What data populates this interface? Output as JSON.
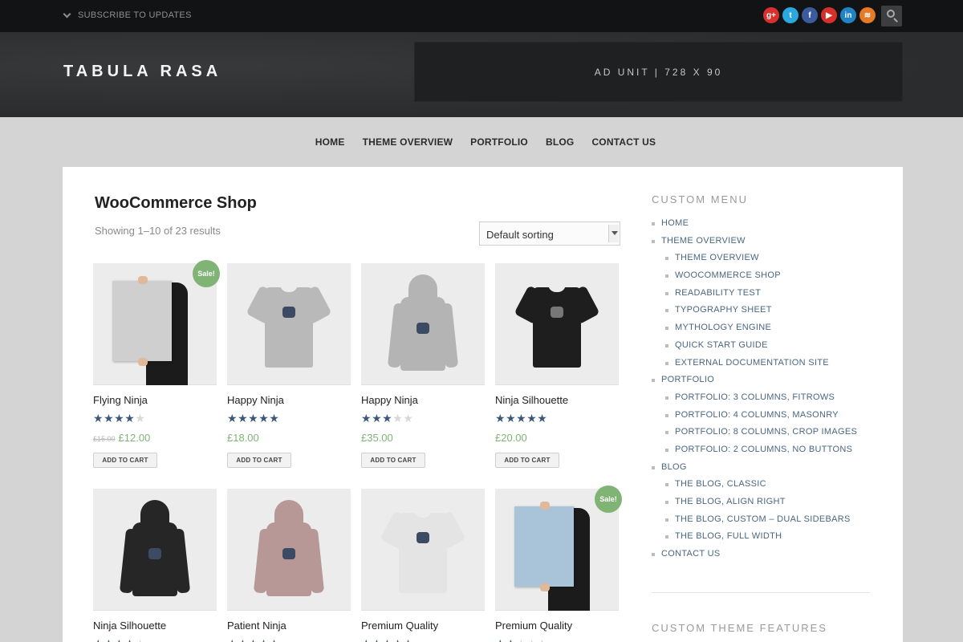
{
  "topbar": {
    "subscribe": "SUBSCRIBE TO UPDATES",
    "social": [
      {
        "icon": "google-plus-icon",
        "glyph": "g+",
        "color": "#d8302f"
      },
      {
        "icon": "twitter-icon",
        "glyph": "t",
        "color": "#2aa9e0"
      },
      {
        "icon": "facebook-icon",
        "glyph": "f",
        "color": "#3b5b9c"
      },
      {
        "icon": "youtube-icon",
        "glyph": "▶",
        "color": "#d6302b"
      },
      {
        "icon": "linkedin-icon",
        "glyph": "in",
        "color": "#1f83c4"
      },
      {
        "icon": "rss-icon",
        "glyph": "≋",
        "color": "#e77a24"
      }
    ]
  },
  "header": {
    "logo": "TABULA RASA",
    "ad": "AD UNIT | 728 X 90"
  },
  "nav": [
    "HOME",
    "THEME OVERVIEW",
    "PORTFOLIO",
    "BLOG",
    "CONTACT US"
  ],
  "shop": {
    "title": "WooCommerce Shop",
    "results": "Showing 1–10 of 23 results",
    "sort": "Default sorting"
  },
  "products": [
    {
      "name": "Flying Ninja",
      "rating": 4,
      "old_price": "£15.00",
      "price": "£12.00",
      "sale": true,
      "kind": "poster",
      "color": "#cfcfcf"
    },
    {
      "name": "Happy Ninja",
      "rating": 5,
      "old_price": "",
      "price": "£18.00",
      "sale": false,
      "kind": "tee",
      "color": "#b9b9b9"
    },
    {
      "name": "Happy Ninja",
      "rating": 3,
      "old_price": "",
      "price": "£35.00",
      "sale": false,
      "kind": "hood",
      "color": "#b4b4b4"
    },
    {
      "name": "Ninja Silhouette",
      "rating": 5,
      "old_price": "",
      "price": "£20.00",
      "sale": false,
      "kind": "tee",
      "color": "#1e1e1e"
    },
    {
      "name": "Ninja Silhouette",
      "rating": 4,
      "old_price": "",
      "price": "",
      "sale": false,
      "kind": "hood",
      "color": "#262626"
    },
    {
      "name": "Patient Ninja",
      "rating": 5,
      "old_price": "",
      "price": "",
      "sale": false,
      "kind": "hood",
      "color": "#b89797"
    },
    {
      "name": "Premium Quality",
      "rating": 5,
      "old_price": "",
      "price": "",
      "sale": false,
      "kind": "tee",
      "color": "#e4e4e4"
    },
    {
      "name": "Premium Quality",
      "rating": 2,
      "old_price": "",
      "price": "",
      "sale": true,
      "kind": "poster",
      "color": "#a9c3d8"
    }
  ],
  "product_labels": {
    "add_to_cart": "ADD TO CART",
    "sale_badge": "Sale!"
  },
  "sidebar": {
    "menu_title": "CUSTOM MENU",
    "menu": [
      {
        "label": "HOME",
        "level": 0
      },
      {
        "label": "THEME OVERVIEW",
        "level": 0
      },
      {
        "label": "THEME OVERVIEW",
        "level": 1
      },
      {
        "label": "WOOCOMMERCE SHOP",
        "level": 1
      },
      {
        "label": "READABILITY TEST",
        "level": 1
      },
      {
        "label": "TYPOGRAPHY SHEET",
        "level": 1
      },
      {
        "label": "MYTHOLOGY ENGINE",
        "level": 1
      },
      {
        "label": "QUICK START GUIDE",
        "level": 1
      },
      {
        "label": "EXTERNAL DOCUMENTATION SITE",
        "level": 1
      },
      {
        "label": "PORTFOLIO",
        "level": 0
      },
      {
        "label": "PORTFOLIO: 3 COLUMNS, FITROWS",
        "level": 1
      },
      {
        "label": "PORTFOLIO: 4 COLUMNS, MASONRY",
        "level": 1
      },
      {
        "label": "PORTFOLIO: 8 COLUMNS, CROP IMAGES",
        "level": 1
      },
      {
        "label": "PORTFOLIO: 2 COLUMNS, NO BUTTONS",
        "level": 1
      },
      {
        "label": "BLOG",
        "level": 0
      },
      {
        "label": "THE BLOG, CLASSIC",
        "level": 1
      },
      {
        "label": "THE BLOG, ALIGN RIGHT",
        "level": 1
      },
      {
        "label": "THE BLOG, CUSTOM – DUAL SIDEBARS",
        "level": 1
      },
      {
        "label": "THE BLOG, FULL WIDTH",
        "level": 1
      },
      {
        "label": "CONTACT US",
        "level": 0
      }
    ],
    "features_title": "CUSTOM THEME FEATURES"
  },
  "colors": {
    "accent_link": "#4b6680",
    "price_green": "#7fb475",
    "star_blue": "#3c5878"
  }
}
